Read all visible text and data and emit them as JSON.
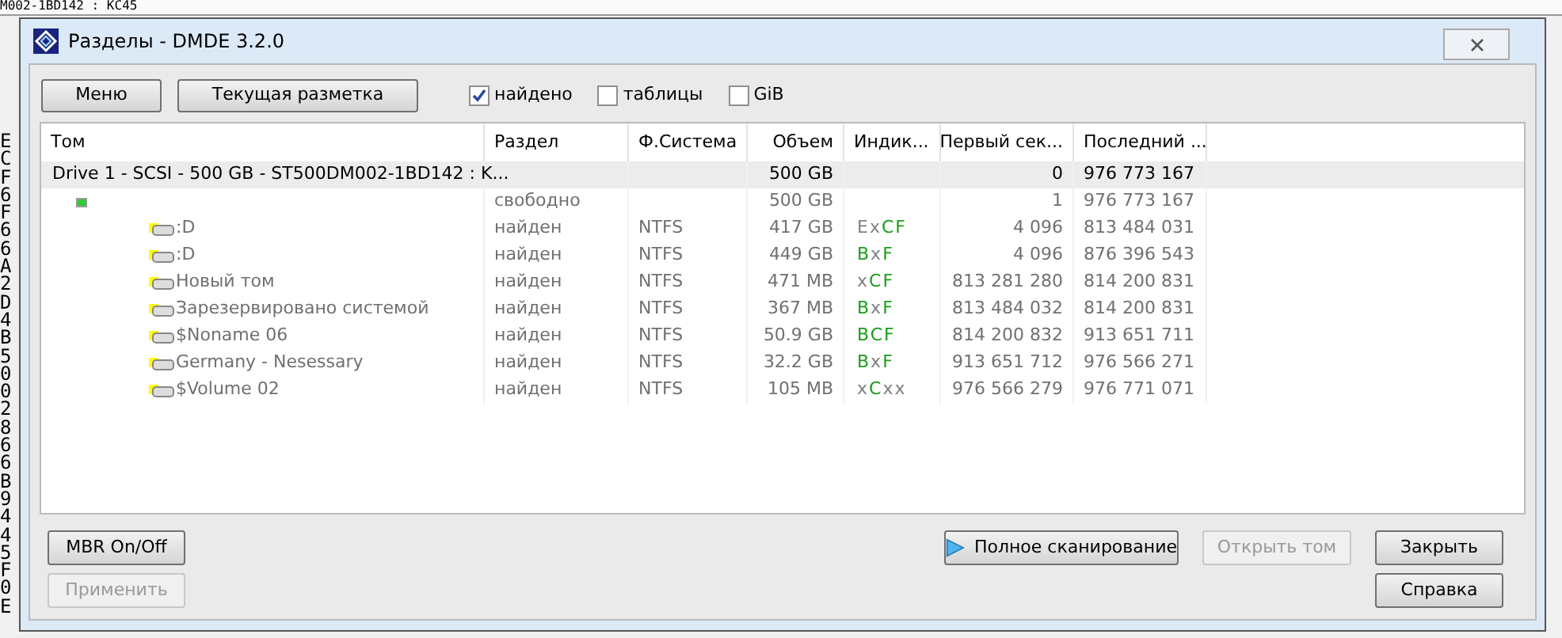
{
  "background": {
    "top_line": "M002-1BD142 : KC45",
    "column_chars": [
      "E",
      "C",
      "F",
      "6",
      "F",
      "6",
      "6",
      "A",
      "2",
      "D",
      "4",
      "B",
      "5",
      "0",
      "0",
      "2",
      "8",
      "6",
      "6",
      "B",
      "9",
      "4",
      "4",
      "5",
      "F",
      "0",
      "E"
    ]
  },
  "window": {
    "title": "Разделы - DMDE 3.2.0"
  },
  "toolbar": {
    "buttons": [
      {
        "label": "Меню"
      },
      {
        "label": "Текущая разметка"
      }
    ],
    "checkboxes": [
      {
        "label": "найдено",
        "checked": true
      },
      {
        "label": "таблицы",
        "checked": false
      },
      {
        "label": "GiB",
        "checked": false
      }
    ]
  },
  "table": {
    "columns": [
      "Том",
      "Раздел",
      "Ф.Система",
      "Объем",
      "Индик...",
      "Первый сек...",
      "Последний ..."
    ],
    "rows": [
      {
        "kind": "drive",
        "name": "Drive 1 - SCSI - 500 GB - ST500DM002-1BD142 : K...",
        "size": "500 GB",
        "first": "0",
        "last": "976 773 167",
        "selected": true,
        "children": [
          {
            "kind": "free",
            "partition": "свободно",
            "size": "500 GB",
            "first": "1",
            "last": "976 773 167",
            "selected": false,
            "children": [
              {
                "kind": "volume",
                "name": ":D",
                "partition": "найден",
                "fs": "NTFS",
                "size": "417 GB",
                "indicator": [
                  {
                    "text": "E",
                    "on": false
                  },
                  {
                    "text": "x",
                    "on": false
                  },
                  {
                    "text": "C",
                    "on": true
                  },
                  {
                    "text": "F",
                    "on": true
                  }
                ],
                "first": "4 096",
                "last": "813 484 031",
                "selected": false
              },
              {
                "kind": "volume",
                "name": ":D",
                "partition": "найден",
                "fs": "NTFS",
                "size": "449 GB",
                "indicator": [
                  {
                    "text": "B",
                    "on": true
                  },
                  {
                    "text": "x",
                    "on": false
                  },
                  {
                    "text": "F",
                    "on": true
                  }
                ],
                "first": "4 096",
                "last": "876 396 543",
                "selected": false
              },
              {
                "kind": "volume",
                "name": "Новый том",
                "partition": "найден",
                "fs": "NTFS",
                "size": "471 MB",
                "indicator": [
                  {
                    "text": "x",
                    "on": false
                  },
                  {
                    "text": "C",
                    "on": true
                  },
                  {
                    "text": "F",
                    "on": true
                  }
                ],
                "first": "813 281 280",
                "last": "814 200 831",
                "selected": false
              },
              {
                "kind": "volume",
                "name": "Зарезервировано системой",
                "partition": "найден",
                "fs": "NTFS",
                "size": "367 MB",
                "indicator": [
                  {
                    "text": "B",
                    "on": true
                  },
                  {
                    "text": "x",
                    "on": false
                  },
                  {
                    "text": "F",
                    "on": true
                  }
                ],
                "first": "813 484 032",
                "last": "814 200 831",
                "selected": false
              },
              {
                "kind": "volume",
                "name": "$Noname 06",
                "partition": "найден",
                "fs": "NTFS",
                "size": "50.9 GB",
                "indicator": [
                  {
                    "text": "B",
                    "on": true
                  },
                  {
                    "text": "C",
                    "on": true
                  },
                  {
                    "text": "F",
                    "on": true
                  }
                ],
                "first": "814 200 832",
                "last": "913 651 711",
                "selected": false
              },
              {
                "kind": "volume",
                "name": "Germany - Nesessary",
                "partition": "найден",
                "fs": "NTFS",
                "size": "32.2 GB",
                "indicator": [
                  {
                    "text": "B",
                    "on": true
                  },
                  {
                    "text": "x",
                    "on": false
                  },
                  {
                    "text": "F",
                    "on": true
                  }
                ],
                "first": "913 651 712",
                "last": "976 566 271",
                "selected": false
              },
              {
                "kind": "volume",
                "name": "$Volume 02",
                "partition": "найден",
                "fs": "NTFS",
                "size": "105 MB",
                "indicator": [
                  {
                    "text": "x",
                    "on": false
                  },
                  {
                    "text": "C",
                    "on": true
                  },
                  {
                    "text": "x",
                    "on": false
                  },
                  {
                    "text": "x",
                    "on": false
                  }
                ],
                "first": "976 566 279",
                "last": "976 771 071",
                "selected": false
              }
            ]
          }
        ]
      }
    ]
  },
  "bottom_buttons": [
    {
      "label": "MBR On/Off",
      "disabled": false,
      "icon": false
    },
    {
      "label": "Применить",
      "disabled": true,
      "icon": false
    },
    {
      "label": "Полное сканирование",
      "disabled": false,
      "icon": true
    },
    {
      "label": "Открыть том",
      "disabled": true,
      "icon": false
    },
    {
      "label": "Закрыть",
      "disabled": false,
      "icon": false
    },
    {
      "label": "Справка",
      "disabled": false,
      "icon": false
    }
  ]
}
